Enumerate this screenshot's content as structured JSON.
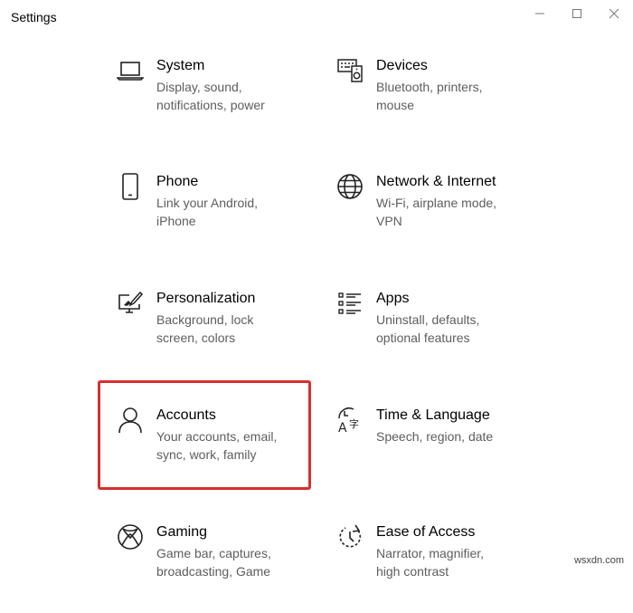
{
  "window": {
    "title": "Settings",
    "minimize_icon": "minimize-icon",
    "maximize_icon": "maximize-icon",
    "close_icon": "close-icon"
  },
  "tiles": [
    {
      "id": "system",
      "icon": "laptop-icon",
      "label": "System",
      "desc1": "Display, sound,",
      "desc2": "notifications, power"
    },
    {
      "id": "devices",
      "icon": "keyboard-speaker-icon",
      "label": "Devices",
      "desc1": "Bluetooth, printers,",
      "desc2": "mouse"
    },
    {
      "id": "phone",
      "icon": "phone-icon",
      "label": "Phone",
      "desc1": "Link your Android,",
      "desc2": "iPhone"
    },
    {
      "id": "network",
      "icon": "globe-icon",
      "label": "Network & Internet",
      "desc1": "Wi-Fi, airplane mode,",
      "desc2": "VPN"
    },
    {
      "id": "personalization",
      "icon": "paint-brush-monitor-icon",
      "label": "Personalization",
      "desc1": "Background, lock",
      "desc2": "screen, colors"
    },
    {
      "id": "apps",
      "icon": "apps-list-icon",
      "label": "Apps",
      "desc1": "Uninstall, defaults,",
      "desc2": "optional features"
    },
    {
      "id": "accounts",
      "icon": "person-icon",
      "label": "Accounts",
      "desc1": "Your accounts, email,",
      "desc2": "sync, work, family"
    },
    {
      "id": "time",
      "icon": "time-language-icon",
      "label": "Time & Language",
      "desc1": "Speech, region, date",
      "desc2": ""
    },
    {
      "id": "gaming",
      "icon": "xbox-icon",
      "label": "Gaming",
      "desc1": "Game bar, captures,",
      "desc2": "broadcasting, Game"
    },
    {
      "id": "ease",
      "icon": "ease-of-access-icon",
      "label": "Ease of Access",
      "desc1": "Narrator, magnifier,",
      "desc2": "high contrast"
    }
  ],
  "highlight_color": "#d62f2f",
  "watermark": "wsxdn.com"
}
